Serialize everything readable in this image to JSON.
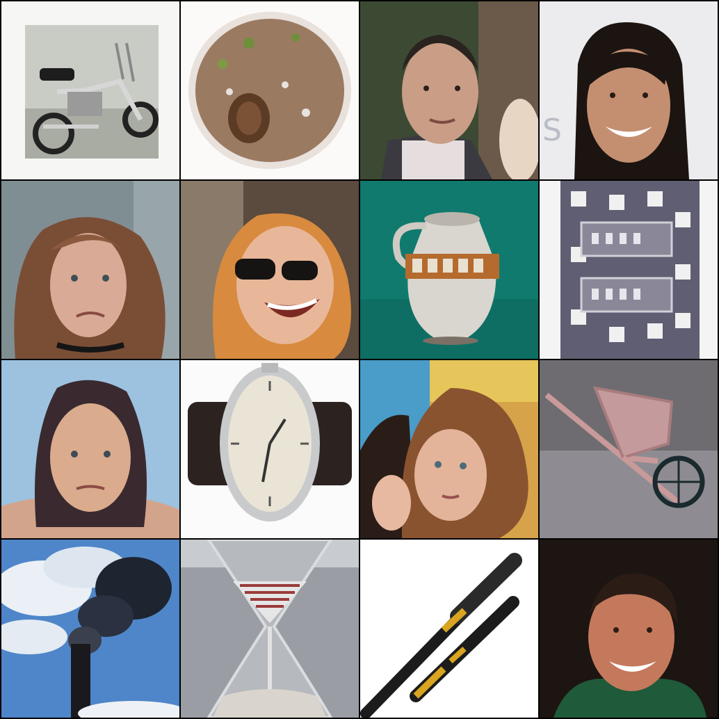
{
  "grid": {
    "rows": 4,
    "columns": 4,
    "border_color": "#000000",
    "tiles": [
      {
        "subject": "motorcycle",
        "icon": "motorcycle-icon"
      },
      {
        "subject": "snail",
        "icon": "snail-icon"
      },
      {
        "subject": "man-portrait",
        "icon": "face-icon"
      },
      {
        "subject": "woman-portrait",
        "icon": "face-icon"
      },
      {
        "subject": "woman-portrait",
        "icon": "face-icon"
      },
      {
        "subject": "woman-sunglasses",
        "icon": "face-icon"
      },
      {
        "subject": "pitcher",
        "icon": "pitcher-icon"
      },
      {
        "subject": "cloth-pattern",
        "icon": "pattern-icon"
      },
      {
        "subject": "woman-portrait",
        "icon": "face-icon"
      },
      {
        "subject": "wristwatch",
        "icon": "watch-icon"
      },
      {
        "subject": "woman-portrait",
        "icon": "face-icon"
      },
      {
        "subject": "wheelbarrow",
        "icon": "wheelbarrow-icon"
      },
      {
        "subject": "smokestack",
        "icon": "smokestack-icon"
      },
      {
        "subject": "hourglass",
        "icon": "hourglass-icon"
      },
      {
        "subject": "baseball-bats",
        "icon": "bat-icon"
      },
      {
        "subject": "man-portrait",
        "icon": "face-icon"
      }
    ]
  }
}
